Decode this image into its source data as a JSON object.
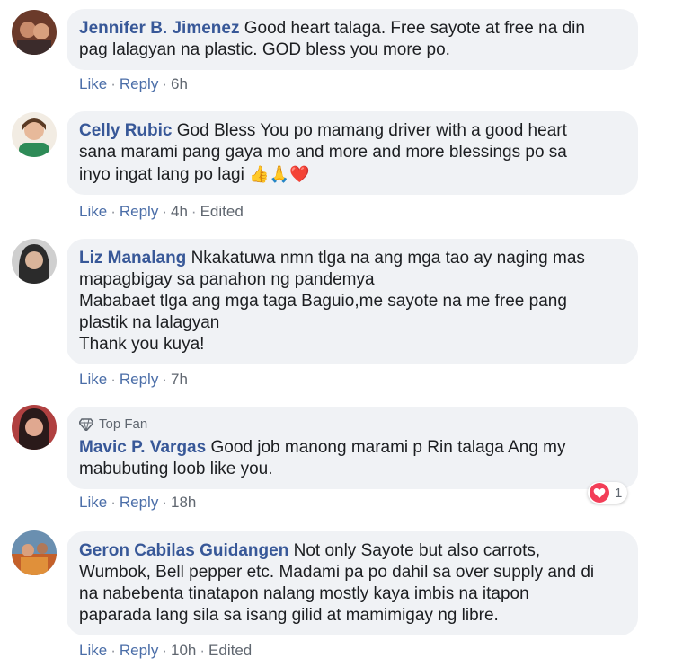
{
  "comments": [
    {
      "author": "Jennifer B. Jimenez",
      "lines": [
        "Good heart talaga. Free sayote at free na din",
        "pag lalagyan na plastic. GOD bless you more po."
      ],
      "like": "Like",
      "reply": "Reply",
      "time": "6h",
      "avatar_colors": [
        "#6b3a2a",
        "#c98b6b"
      ]
    },
    {
      "author": "Celly Rubic",
      "lines": [
        "God Bless You po mamang driver with a good heart",
        "sana marami pang gaya mo and more and more blessings po sa",
        "inyo ingat lang po lagi"
      ],
      "emojis": [
        "👍",
        "🙏",
        "❤️"
      ],
      "like": "Like",
      "reply": "Reply",
      "time": "4h",
      "edited": "Edited",
      "avatar_colors": [
        "#2e8b57",
        "#e7b99a"
      ]
    },
    {
      "author": "Liz Manalang",
      "lines": [
        "Nkakatuwa nmn tlga na ang mga tao ay naging mas",
        "mapagbigay sa panahon ng pandemya",
        "Mababaet tlga ang mga taga Baguio,me sayote na me free pang",
        "plastik na lalagyan",
        "Thank you kuya!"
      ],
      "like": "Like",
      "reply": "Reply",
      "time": "7h",
      "avatar_colors": [
        "#2b2b2b",
        "#d9b49a"
      ]
    },
    {
      "badge": "Top Fan",
      "author": "Mavic P. Vargas",
      "lines": [
        "Good job manong marami p Rin talaga Ang my",
        "mabubuting loob like you."
      ],
      "like": "Like",
      "reply": "Reply",
      "time": "18h",
      "reaction_count": "1",
      "avatar_colors": [
        "#8b1a1a",
        "#e0a890"
      ]
    },
    {
      "author": "Geron Cabilas Guidangen",
      "lines": [
        "Not only Sayote but also carrots,",
        "Wumbok, Bell pepper etc. Madami pa po dahil sa over supply and di",
        "na nabebenta tinatapon nalang mostly kaya imbis na itapon",
        "paparada lang sila sa isang gilid at mamimigay ng libre."
      ],
      "like": "Like",
      "reply": "Reply",
      "time": "10h",
      "edited": "Edited",
      "avatar_colors": [
        "#c4602a",
        "#6a8fb0"
      ]
    }
  ]
}
